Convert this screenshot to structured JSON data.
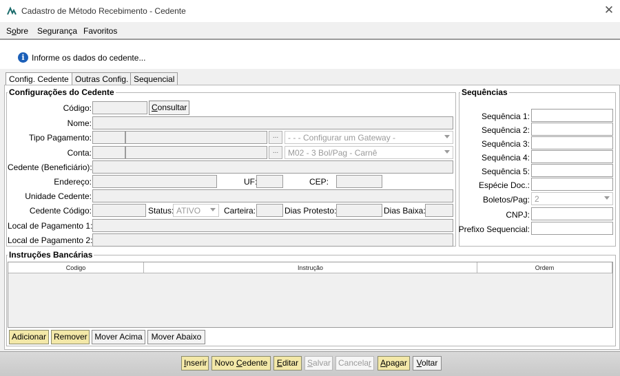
{
  "window": {
    "title": "Cadastro de Método Recebimento - Cedente",
    "app_icon": "app-logo-icon",
    "close_icon": "close-icon"
  },
  "menu": {
    "sobre_prefix": "S",
    "sobre_underlined": "o",
    "sobre_rest": "bre",
    "seguranca": "Segurança",
    "favoritos": "Favoritos"
  },
  "header": {
    "info_icon": "info-icon",
    "message": "Informe os dados do cedente..."
  },
  "tabs": [
    {
      "label": "Config. Cedente",
      "active": true
    },
    {
      "label": "Outras Config.",
      "active": false
    },
    {
      "label": "Sequencial",
      "active": false
    }
  ],
  "config": {
    "group_title": "Configurações do Cedente",
    "codigo_label": "Código:",
    "consultar_prefix": "C",
    "consultar_rest": "onsultar",
    "nome_label": "Nome:",
    "tipo_pagamento_label": "Tipo Pagamento:",
    "gateway_value": "- - - Configurar um Gateway -",
    "conta_label": "Conta:",
    "conta_combo_value": "M02 - 3 Bol/Pag - Carnê",
    "cedente_label": "Cedente (Beneficiário):",
    "endereco_label": "Endereço:",
    "uf_label": "UF:",
    "cep_label": "CEP:",
    "unidade_label": "Unidade Cedente:",
    "cedente_codigo_label": "Cedente Código:",
    "status_label": "Status:",
    "status_value": "ATIVO",
    "carteira_label": "Carteira:",
    "dias_protesto_label": "Dias Protesto:",
    "dias_baixa_label": "Dias Baixa:",
    "local_pag1_label": "Local de Pagamento 1:",
    "local_pag2_label": "Local de Pagamento 2:",
    "ellipsis": "..."
  },
  "sequencias": {
    "group_title": "Sequências",
    "seq1_label": "Sequência 1:",
    "seq2_label": "Sequência 2:",
    "seq3_label": "Sequência 3:",
    "seq4_label": "Sequência 4:",
    "seq5_label": "Sequência 5:",
    "especie_label": "Espécie Doc.:",
    "boletos_label": "Boletos/Pag:",
    "boletos_value": "2",
    "cnpj_label": "CNPJ:",
    "prefixo_label": "Prefixo Sequencial:"
  },
  "instrucoes": {
    "group_title": "Instruções Bancárias",
    "columns": [
      "Codigo",
      "Instrução",
      "Ordem"
    ],
    "adicionar": "Adicionar",
    "remover": "Remover",
    "mover_acima": "Mover Acima",
    "mover_abaixo": "Mover Abaixo"
  },
  "footer": {
    "inserir_u": "I",
    "inserir_rest": "nserir",
    "novo_prefix": "Novo ",
    "novo_u": "C",
    "novo_rest": "edente",
    "editar_u": "E",
    "editar_rest": "ditar",
    "salvar_u": "S",
    "salvar_rest": "alvar",
    "cancelar_prefix": "Cancela",
    "cancelar_u": "r",
    "apagar_u": "A",
    "apagar_rest": "pagar",
    "voltar_u": "V",
    "voltar_rest": "oltar"
  }
}
